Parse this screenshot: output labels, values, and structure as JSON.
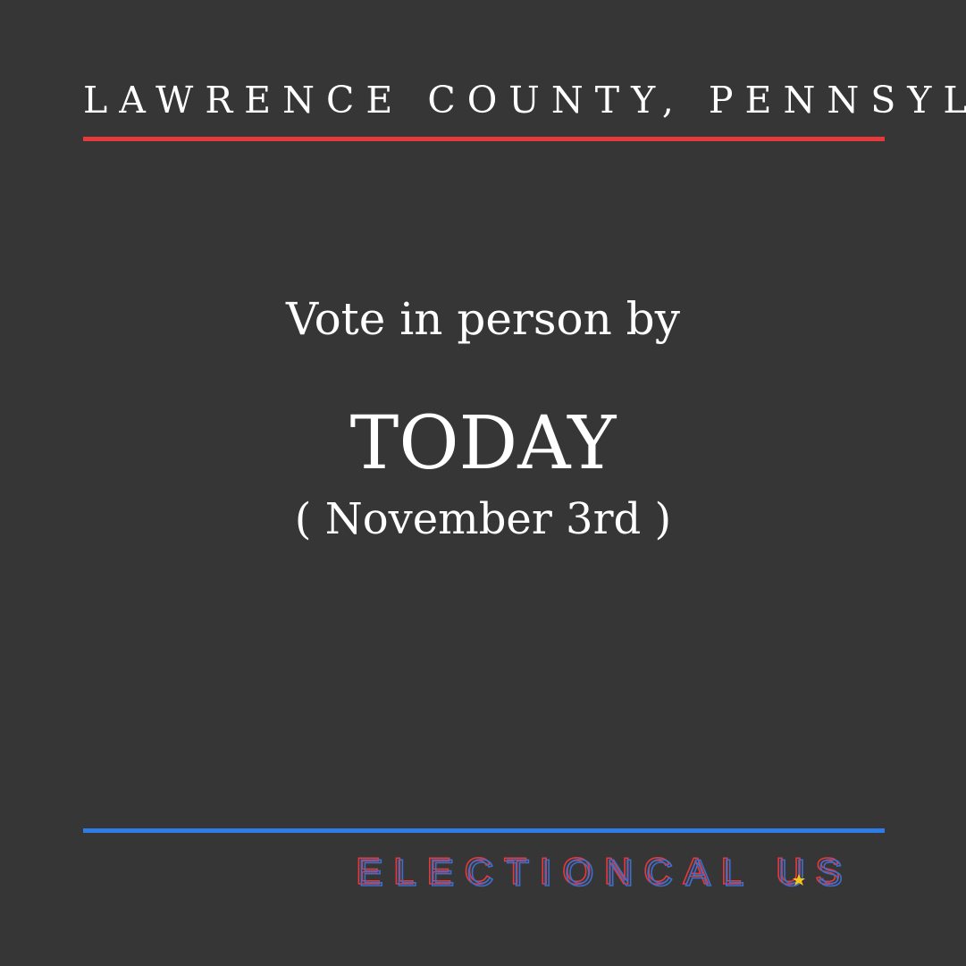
{
  "county": "LAWRENCE COUNTY, PENNSYLVANIA",
  "headline": "Vote in person by",
  "deadline": "TODAY",
  "date": "( November 3rd )",
  "brand": {
    "text": "ELECTIONCAL.US",
    "colors": {
      "red": "#e8393a",
      "blue": "#3b6fd0",
      "star": "#f5c518"
    }
  },
  "colors": {
    "background": "#363636",
    "top_rule": "#e8393a",
    "bottom_rule": "#2f7be8",
    "text": "#ffffff"
  }
}
